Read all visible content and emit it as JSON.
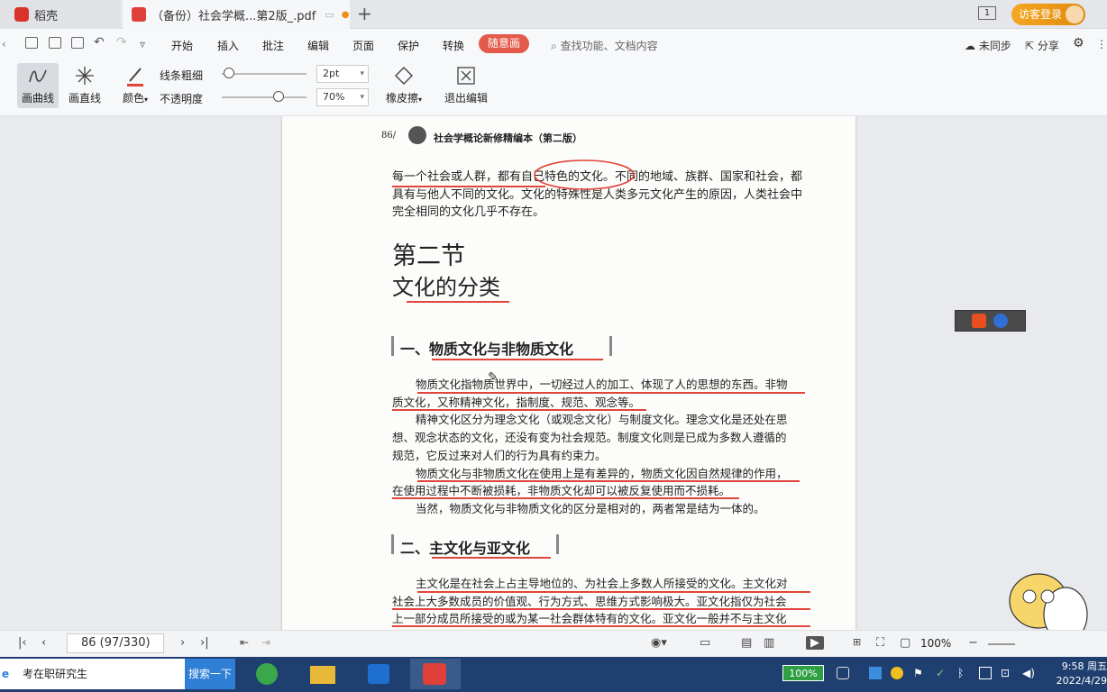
{
  "tabs": [
    {
      "label": "稻壳"
    },
    {
      "label": "（备份）社会学概...第2版_.pdf"
    }
  ],
  "window": {
    "count": "1",
    "login_label": "访客登录"
  },
  "menu": {
    "items": [
      "开始",
      "插入",
      "批注",
      "编辑",
      "页面",
      "保护",
      "转换"
    ],
    "active": "随意画",
    "search_placeholder": "查找功能、文档内容",
    "sync_label": "未同步",
    "share_label": "分享"
  },
  "toolbar": {
    "curve_label": "画曲线",
    "line_label": "画直线",
    "color_label": "颜色",
    "width_label": "线条粗细",
    "width_value": "2pt",
    "opacity_label": "不透明度",
    "opacity_value": "70%",
    "eraser_label": "橡皮擦",
    "exit_label": "退出编辑"
  },
  "document": {
    "page_header": "86/",
    "book_title": "社会学概论新修精编本（第二版）",
    "para1": [
      "每一个社会或人群，都有自己特色的文化。不同的地域、族群、国家和社会，都",
      "具有与他人不同的文化。文化的特殊性是人类多元文化产生的原因，人类社会中",
      "完全相同的文化几乎不存在。"
    ],
    "section_title_1": "第二节",
    "section_title_2": "文化的分类",
    "heading1": "一、物质文化与非物质文化",
    "para2": [
      "物质文化指物质世界中，一切经过人的加工、体现了人的思想的东西。非物",
      "质文化，又称精神文化，指制度、规范、观念等。",
      "精神文化区分为理念文化（或观念文化）与制度文化。理念文化是还处在思",
      "想、观念状态的文化，还没有变为社会规范。制度文化则是已成为多数人遵循的",
      "规范，它反过来对人们的行为具有约束力。",
      "物质文化与非物质文化在使用上是有差异的，物质文化因自然规律的作用，",
      "在使用过程中不断被损耗，非物质文化却可以被反复使用而不损耗。",
      "当然，物质文化与非物质文化的区分是相对的，两者常是结为一体的。"
    ],
    "heading2": "二、主文化与亚文化",
    "para3": [
      "主文化是在社会上占主导地位的、为社会上多数人所接受的文化。主文化对",
      "社会上大多数成员的价值观、行为方式、思维方式影响极大。亚文化指仅为社会",
      "上一部分成员所接受的或为某一社会群体特有的文化。亚文化一般并不与主文化"
    ]
  },
  "status": {
    "page_indicator": "86 (97/330)",
    "zoom": "100%"
  },
  "taskbar": {
    "search_text": "考在职研究生",
    "search_button": "搜索一下",
    "battery": "100%",
    "time": "9:58 周五",
    "date": "2022/4/29"
  },
  "colors": {
    "accent": "#e35a4a",
    "annotation": "#e2453a",
    "taskbar": "#1f3f70"
  }
}
